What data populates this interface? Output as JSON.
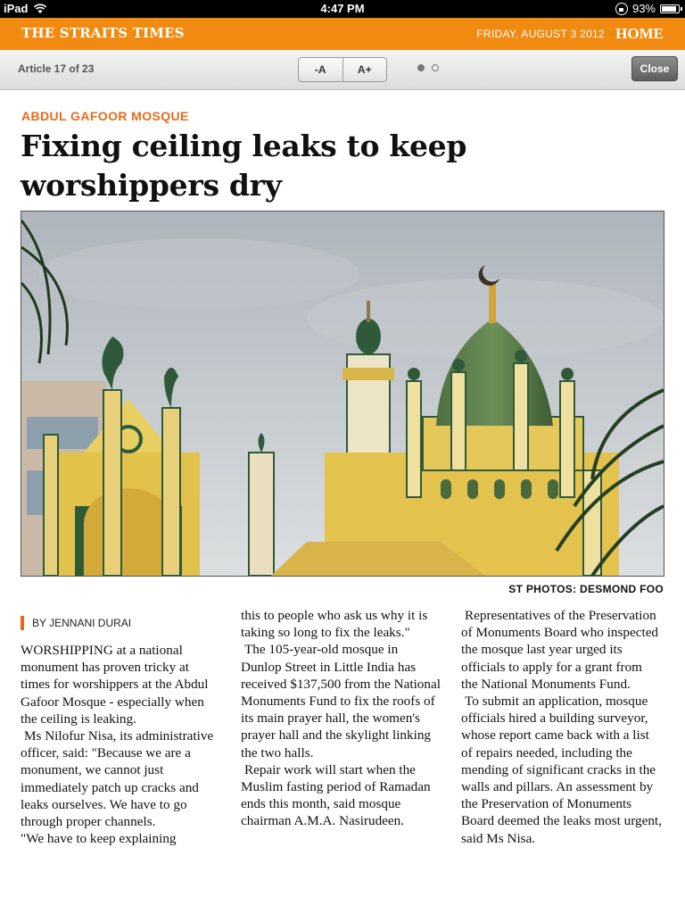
{
  "status_bar": {
    "device": "iPad",
    "time": "4:47 PM",
    "battery": "93%",
    "battery_level": 0.93
  },
  "masthead": {
    "publication": "THE STRAITS TIMES",
    "date": "FRIDAY, AUGUST 3 2012",
    "home": "HOME"
  },
  "toolbar": {
    "article_counter": "Article 17 of 23",
    "decrease_font": "-A",
    "increase_font": "A+",
    "close": "Close",
    "page_indicator": {
      "current": 1,
      "total": 2
    }
  },
  "article": {
    "kicker": "ABDUL GAFOOR MOSQUE",
    "headline": "Fixing ceiling leaks to keep worshippers dry",
    "photo_credit": "ST PHOTOS: DESMOND FOO",
    "byline": "BY JENNANI DURAI",
    "columns": [
      [
        "WORSHIPPING at a national monument has proven tricky at times for worshippers at the Abdul Gafoor Mosque - especially when the ceiling is leaking.",
        "Ms Nilofur Nisa, its administrative officer, said: \"Because we are a monument, we cannot just immediately patch up cracks and leaks ourselves. We have to go through proper channels.",
        "\"We have to keep explaining"
      ],
      [
        "this to people who ask us why it is taking so long to fix the leaks.\"",
        "The 105-year-old mosque in Dunlop Street in Little India has received $137,500 from the National Monuments Fund to fix the roofs of its main prayer hall, the women's prayer hall and the skylight linking the two halls.",
        "Repair work will start when the Muslim fasting period of Ramadan ends this month, said mosque chairman A.M.A. Nasirudeen."
      ],
      [
        "Representatives of the Preservation of Monuments Board who inspected the mosque last year urged its officials to apply for a grant from the National Monuments Fund.",
        "To submit an application, mosque officials hired a building surveyor, whose report came back with a list of repairs needed, including the mending of significant cracks in the walls and pillars. An assessment by the Preservation of Monuments Board deemed the leaks most urgent, said Ms Nisa."
      ]
    ]
  }
}
